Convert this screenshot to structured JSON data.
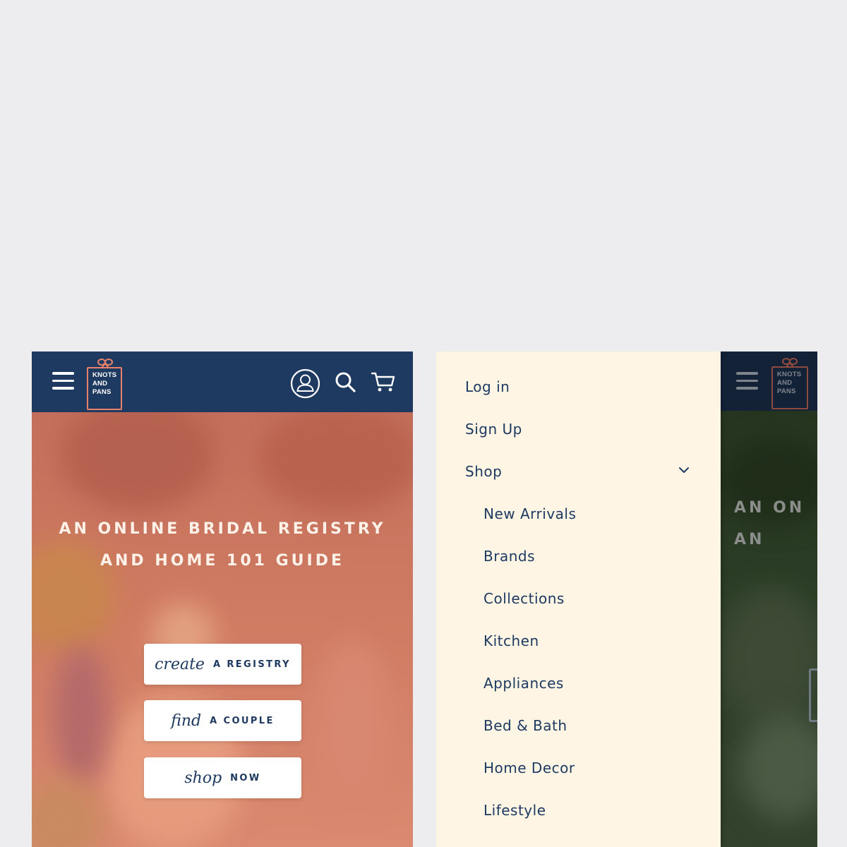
{
  "brand": {
    "logo_lines": [
      "KNOTS",
      "AND",
      "PANS"
    ],
    "colors": {
      "navy": "#1e3a61",
      "coral": "#e9806a",
      "cream": "#fef5e5",
      "hero_overlay": "#c9705c"
    }
  },
  "header": {
    "icons": [
      "hamburger-menu-icon",
      "account-icon",
      "search-icon",
      "cart-icon"
    ]
  },
  "hero": {
    "headline": "AN ONLINE BRIDAL REGISTRY\nAND HOME 101 GUIDE",
    "buttons": [
      {
        "script": "create",
        "caps": "A REGISTRY"
      },
      {
        "script": "find",
        "caps": "A COUPLE"
      },
      {
        "script": "shop",
        "caps": "NOW"
      }
    ]
  },
  "drawer": {
    "top_items": [
      "Log in",
      "Sign Up",
      "Shop"
    ],
    "shop_expanded": true,
    "shop_subitems": [
      "New Arrivals",
      "Brands",
      "Collections",
      "Kitchen",
      "Appliances",
      "Bed & Bath",
      "Home Decor",
      "Lifestyle"
    ]
  },
  "background_page": {
    "headline_visible": "AN ON\nAN"
  }
}
